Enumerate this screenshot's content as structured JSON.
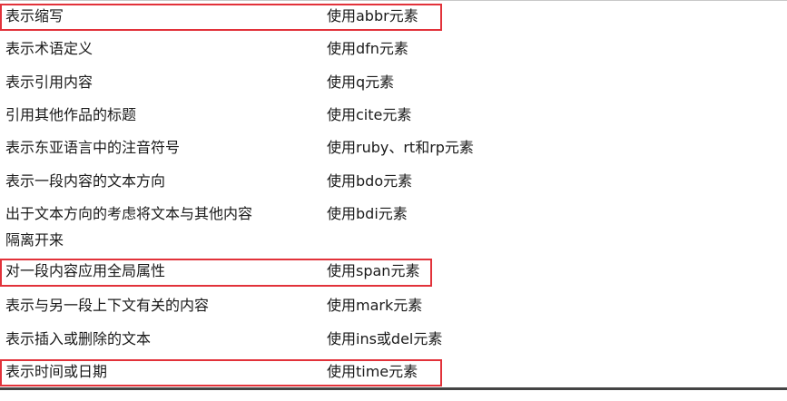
{
  "rows": [
    {
      "task": "表示缩写",
      "element": "使用abbr元素",
      "highlighted": true
    },
    {
      "task": "表示术语定义",
      "element": "使用dfn元素",
      "highlighted": false
    },
    {
      "task": "表示引用内容",
      "element": "使用q元素",
      "highlighted": false
    },
    {
      "task": "引用其他作品的标题",
      "element": "使用cite元素",
      "highlighted": false
    },
    {
      "task": "表示东亚语言中的注音符号",
      "element": "使用ruby、rt和rp元素",
      "highlighted": false
    },
    {
      "task": "表示一段内容的文本方向",
      "element": "使用bdo元素",
      "highlighted": false
    },
    {
      "task": "出于文本方向的考虑将文本与其他内容\n隔离开来",
      "element": "使用bdi元素",
      "highlighted": false
    },
    {
      "task": "对一段内容应用全局属性",
      "element": "使用span元素",
      "highlighted": true
    },
    {
      "task": "表示与另一段上下文有关的内容",
      "element": "使用mark元素",
      "highlighted": false
    },
    {
      "task": "表示插入或删除的文本",
      "element": "使用ins或del元素",
      "highlighted": false
    },
    {
      "task": "表示时间或日期",
      "element": "使用time元素",
      "highlighted": true
    }
  ],
  "colors": {
    "highlight_border": "#e2323a",
    "text": "#1a1a1a",
    "rule": "#444444"
  }
}
